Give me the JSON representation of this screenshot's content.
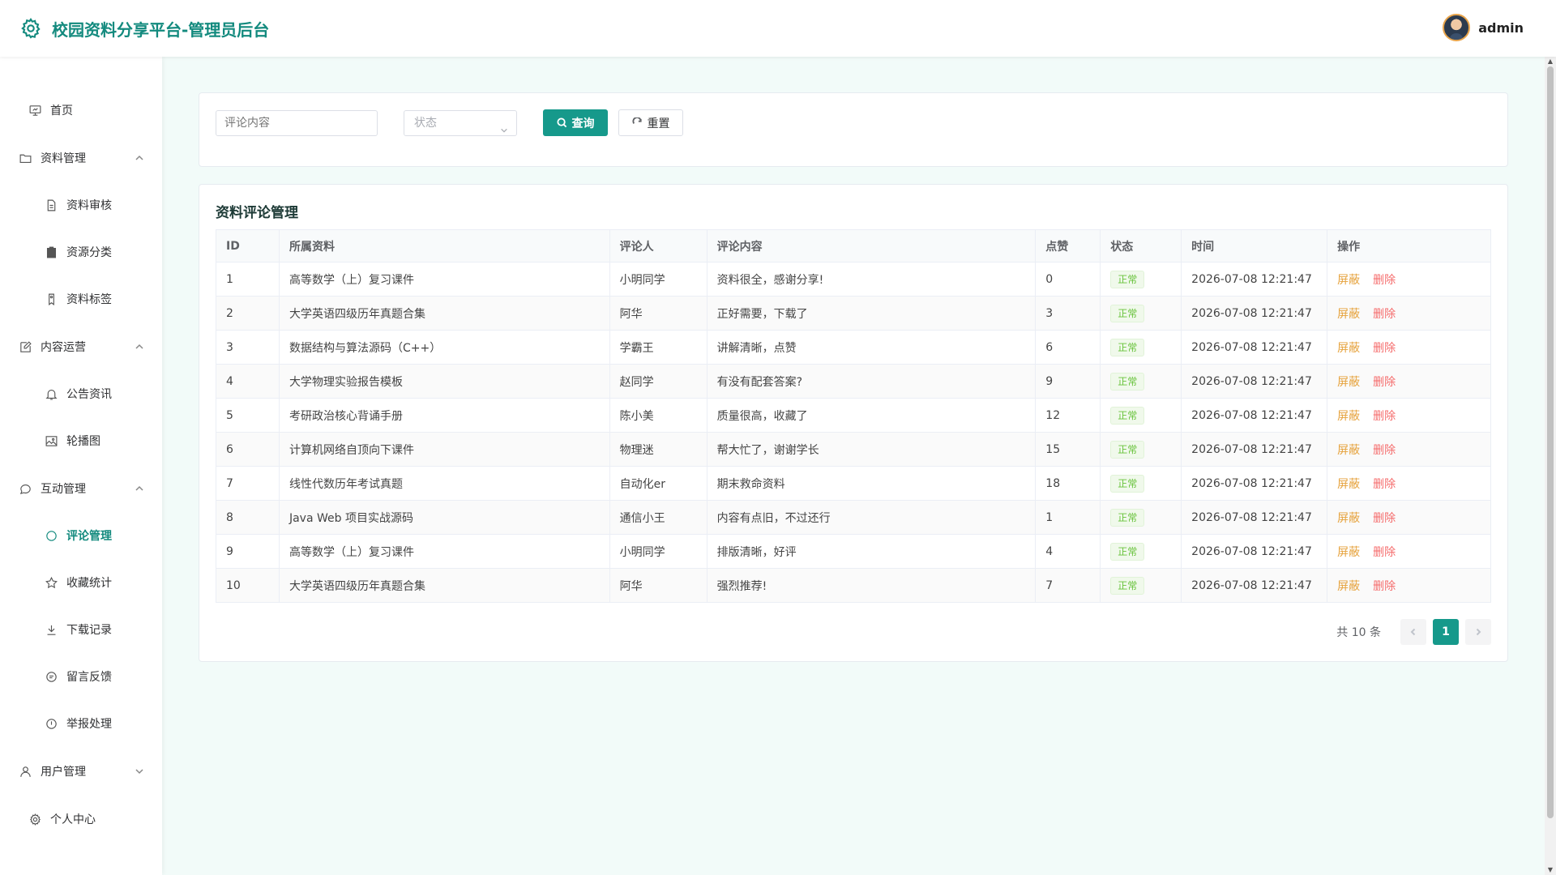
{
  "header": {
    "title": "校园资料分享平台-管理员后台",
    "username": "admin"
  },
  "sidebar": {
    "home": "首页",
    "groups": [
      {
        "label": "资料管理",
        "items": [
          "资料审核",
          "资源分类",
          "资料标签"
        ]
      },
      {
        "label": "内容运营",
        "items": [
          "公告资讯",
          "轮播图"
        ]
      },
      {
        "label": "互动管理",
        "items": [
          "评论管理",
          "收藏统计",
          "下载记录",
          "留言反馈",
          "举报处理"
        ]
      },
      {
        "label": "用户管理",
        "items": []
      }
    ],
    "profile": "个人中心",
    "active": "评论管理"
  },
  "search": {
    "content_placeholder": "评论内容",
    "status_placeholder": "状态",
    "query_label": "查询",
    "reset_label": "重置"
  },
  "table": {
    "title": "资料评论管理",
    "columns": [
      "ID",
      "所属资料",
      "评论人",
      "评论内容",
      "点赞",
      "状态",
      "时间",
      "操作"
    ],
    "rows": [
      {
        "id": "1",
        "material": "高等数学（上）复习课件",
        "commenter": "小明同学",
        "content": "资料很全，感谢分享!",
        "likes": "0",
        "status": "正常",
        "time": "2026-07-08 12:21:47"
      },
      {
        "id": "2",
        "material": "大学英语四级历年真题合集",
        "commenter": "阿华",
        "content": "正好需要，下载了",
        "likes": "3",
        "status": "正常",
        "time": "2026-07-08 12:21:47"
      },
      {
        "id": "3",
        "material": "数据结构与算法源码（C++）",
        "commenter": "学霸王",
        "content": "讲解清晰，点赞",
        "likes": "6",
        "status": "正常",
        "time": "2026-07-08 12:21:47"
      },
      {
        "id": "4",
        "material": "大学物理实验报告模板",
        "commenter": "赵同学",
        "content": "有没有配套答案?",
        "likes": "9",
        "status": "正常",
        "time": "2026-07-08 12:21:47"
      },
      {
        "id": "5",
        "material": "考研政治核心背诵手册",
        "commenter": "陈小美",
        "content": "质量很高，收藏了",
        "likes": "12",
        "status": "正常",
        "time": "2026-07-08 12:21:47"
      },
      {
        "id": "6",
        "material": "计算机网络自顶向下课件",
        "commenter": "物理迷",
        "content": "帮大忙了，谢谢学长",
        "likes": "15",
        "status": "正常",
        "time": "2026-07-08 12:21:47"
      },
      {
        "id": "7",
        "material": "线性代数历年考试真题",
        "commenter": "自动化er",
        "content": "期末救命资料",
        "likes": "18",
        "status": "正常",
        "time": "2026-07-08 12:21:47"
      },
      {
        "id": "8",
        "material": "Java Web 项目实战源码",
        "commenter": "通信小王",
        "content": "内容有点旧，不过还行",
        "likes": "1",
        "status": "正常",
        "time": "2026-07-08 12:21:47"
      },
      {
        "id": "9",
        "material": "高等数学（上）复习课件",
        "commenter": "小明同学",
        "content": "排版清晰，好评",
        "likes": "4",
        "status": "正常",
        "time": "2026-07-08 12:21:47"
      },
      {
        "id": "10",
        "material": "大学英语四级历年真题合集",
        "commenter": "阿华",
        "content": "强烈推荐!",
        "likes": "7",
        "status": "正常",
        "time": "2026-07-08 12:21:47"
      }
    ],
    "action_block": "屏蔽",
    "action_delete": "删除"
  },
  "pagination": {
    "total_text": "共 10 条",
    "current_page": "1"
  },
  "colors": {
    "primary": "#16998b",
    "title": "#138a7e",
    "warn": "#e6a23c",
    "danger": "#f56c6c",
    "success": "#67c23a"
  }
}
